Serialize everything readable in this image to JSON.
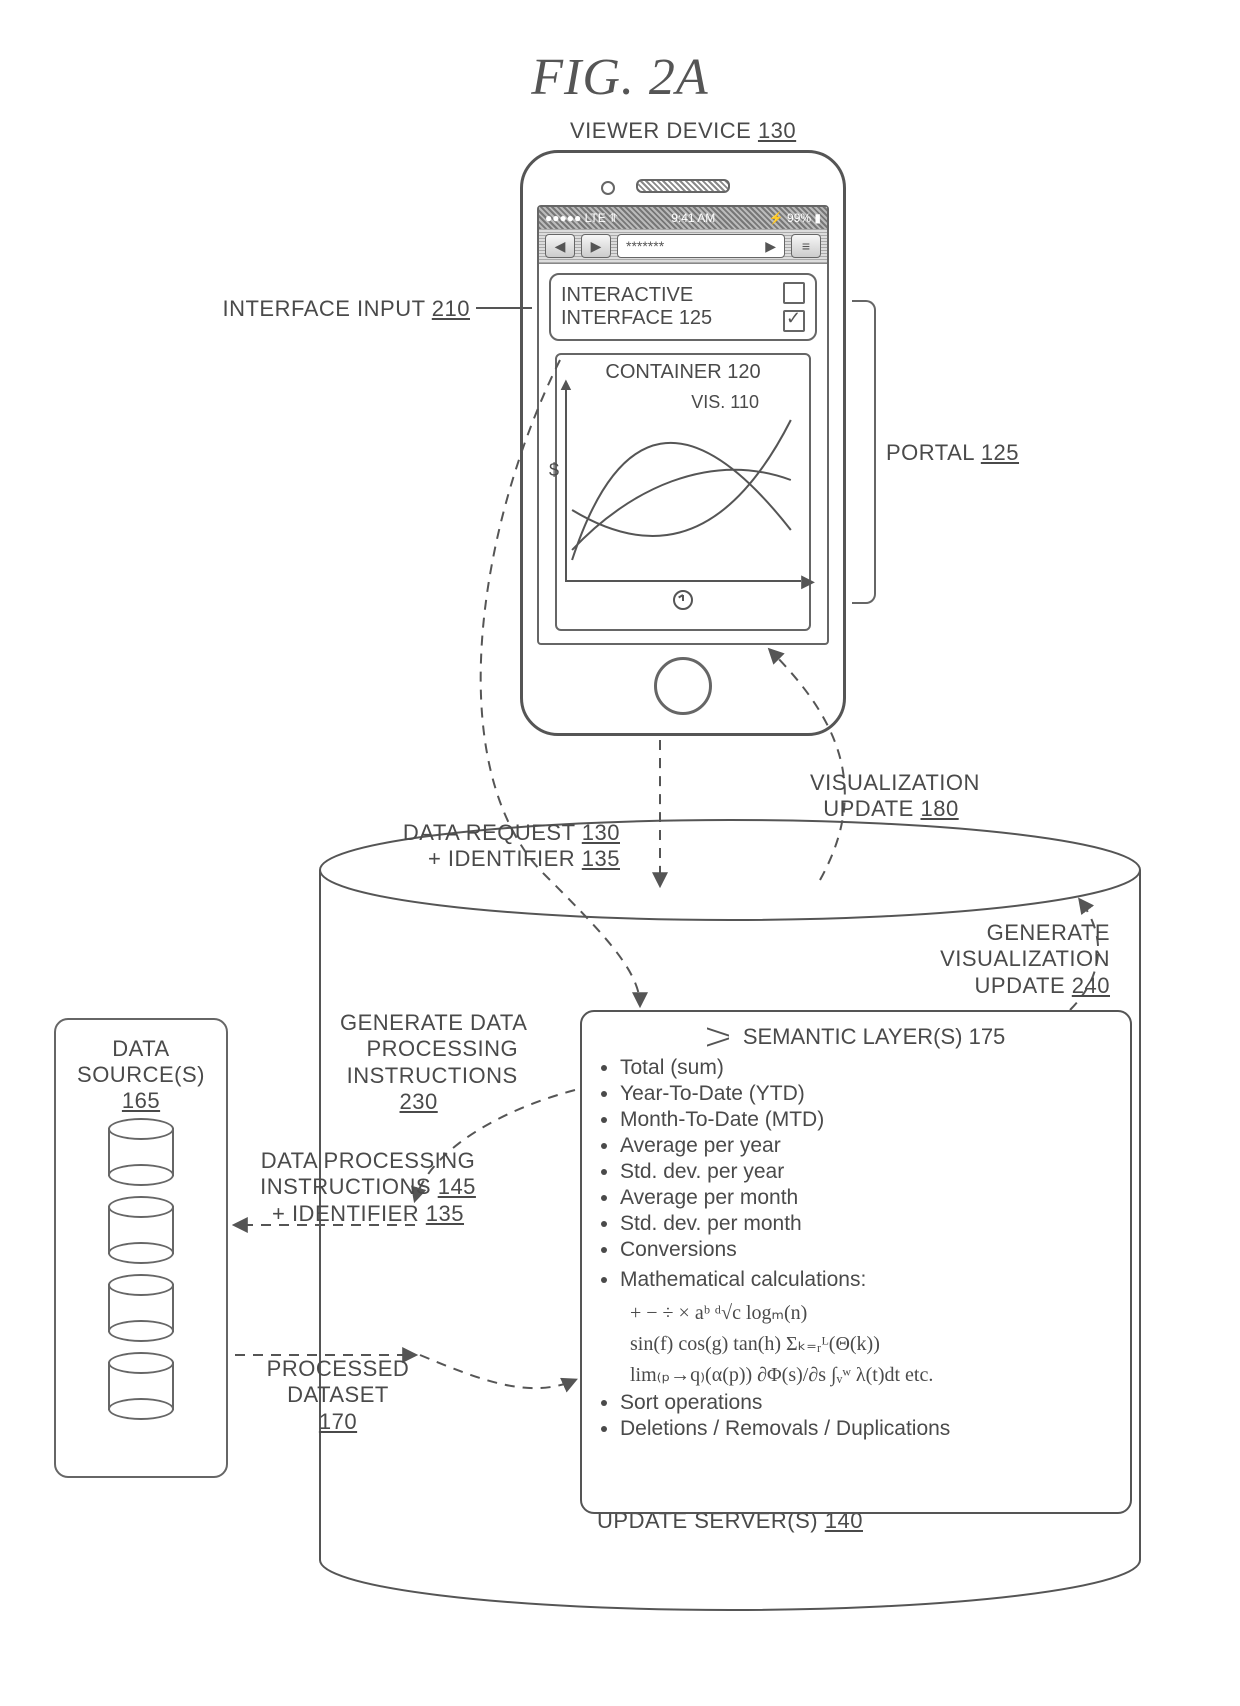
{
  "figure_title": "FIG. 2A",
  "labels": {
    "viewer_device": {
      "text": "VIEWER DEVICE",
      "ref": "130"
    },
    "interface_input": {
      "text": "INTERFACE INPUT",
      "ref": "210"
    },
    "portal": {
      "text": "PORTAL",
      "ref": "125"
    },
    "interactive_interface": {
      "text": "INTERACTIVE",
      "text2": "INTERFACE",
      "ref": "125"
    },
    "container": {
      "text": "CONTAINER",
      "ref": "120"
    },
    "vis": {
      "text": "VIS.",
      "ref": "110"
    },
    "y_axis_symbol": "$",
    "data_request": {
      "text": "DATA REQUEST",
      "ref": "130"
    },
    "identifier": {
      "text": "+ IDENTIFIER",
      "ref": "135"
    },
    "visualization_update": {
      "text": "VISUALIZATION",
      "text2": "UPDATE",
      "ref": "180"
    },
    "generate_vis_update": {
      "text": "GENERATE",
      "text2": "VISUALIZATION",
      "text3": "UPDATE",
      "ref": "240"
    },
    "generate_data_proc": {
      "text": "GENERATE DATA",
      "text2": "PROCESSING",
      "text3": "INSTRUCTIONS",
      "ref": "230"
    },
    "data_sources": {
      "text": "DATA",
      "text2": "SOURCE(S)",
      "ref": "165"
    },
    "data_proc_instructions": {
      "text": "DATA PROCESSING",
      "text2": "INSTRUCTIONS",
      "ref": "145"
    },
    "identifier2": {
      "text": "+ IDENTIFIER",
      "ref": "135"
    },
    "processed_dataset": {
      "text": "PROCESSED",
      "text2": "DATASET",
      "ref": "170"
    },
    "update_servers": {
      "text": "UPDATE SERVER(S)",
      "ref": "140"
    },
    "semantic_layers": {
      "text": "SEMANTIC LAYER(S)",
      "ref": "175"
    }
  },
  "status_bar": {
    "carrier": "●●●●● LTE ⥣",
    "time": "9:41 AM",
    "battery": "⚡ 99% ▮"
  },
  "address_bar": {
    "text": "*******",
    "play": "▶"
  },
  "semantic_items": [
    "Total (sum)",
    "Year-To-Date (YTD)",
    "Month-To-Date (MTD)",
    "Average per year",
    "Std. dev. per year",
    "Average per month",
    "Std. dev. per month",
    "Conversions"
  ],
  "semantic_math_header": "Mathematical calculations:",
  "semantic_math_lines": [
    "+   −   ÷   ×    aᵇ    ᵈ√c    logₘ(n)",
    "sin(f)   cos(g)   tan(h)   Σₖ₌ᵣᴸ(Θ(k))",
    "lim₍ₚ→q₎(α(p))      ∂Φ(s)/∂s      ∫ᵥʷ λ(t)dt     etc."
  ],
  "semantic_tail": [
    "Sort operations",
    "Deletions / Removals / Duplications"
  ]
}
